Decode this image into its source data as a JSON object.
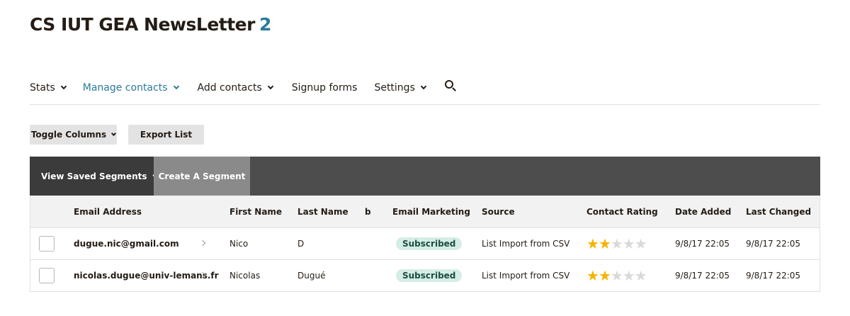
{
  "header": {
    "title": "CS IUT GEA NewsLetter",
    "count": "2"
  },
  "nav": {
    "stats": "Stats",
    "manage_contacts": "Manage contacts",
    "add_contacts": "Add contacts",
    "signup_forms": "Signup forms",
    "settings": "Settings",
    "search_icon": "search-icon",
    "active_color": "#2b7a9b"
  },
  "toolbar": {
    "toggle_columns": "Toggle Columns",
    "export_list": "Export List"
  },
  "segments": {
    "view_saved": "View Saved Segments",
    "create": "Create A Segment"
  },
  "table": {
    "columns": {
      "email": "Email Address",
      "first_name": "First Name",
      "last_name": "Last Name",
      "b": "b",
      "email_marketing": "Email Marketing",
      "source": "Source",
      "contact_rating": "Contact Rating",
      "date_added": "Date Added",
      "last_changed": "Last Changed"
    },
    "rows": [
      {
        "email": "dugue.nic@gmail.com",
        "first_name": "Nico",
        "last_name": "D",
        "b": "",
        "email_marketing": "Subscribed",
        "source": "List Import from CSV",
        "rating": 2,
        "rating_max": 5,
        "date_added": "9/8/17 22:05",
        "last_changed": "9/8/17 22:05"
      },
      {
        "email": "nicolas.dugue@univ-lemans.fr",
        "first_name": "Nicolas",
        "last_name": "Dugué",
        "b": "",
        "email_marketing": "Subscribed",
        "source": "List Import from CSV",
        "rating": 2,
        "rating_max": 5,
        "date_added": "9/8/17 22:05",
        "last_changed": "9/8/17 22:05"
      }
    ]
  },
  "colors": {
    "subscribed_bg": "#d4ede6",
    "star_on": "#f5b400",
    "star_off": "#d9d9d9",
    "segment_bar": "#4d4d4d"
  }
}
